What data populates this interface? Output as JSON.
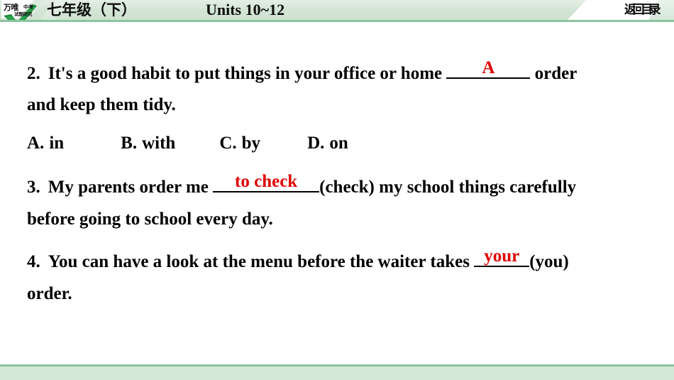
{
  "header": {
    "logo": {
      "brand_main": "万唯",
      "brand_sup": "中考",
      "brand_sub": "试题研究",
      "check_icon": "check-mark"
    },
    "title_cn": "七年级（下）",
    "title_en": "Units 10~12",
    "return_button": "返回目录"
  },
  "questions": [
    {
      "number": "2.",
      "line1_before": "It's a good habit to put things in your office or home",
      "answer": "A",
      "line1_after": "order",
      "line2": "and keep them tidy.",
      "options": [
        {
          "label": "A.",
          "text": "in"
        },
        {
          "label": "B.",
          "text": "with"
        },
        {
          "label": "C.",
          "text": "by"
        },
        {
          "label": "D.",
          "text": "on"
        }
      ]
    },
    {
      "number": "3.",
      "line1_before": "My parents order me",
      "answer": "to check",
      "line1_after": "(check) my school things carefully",
      "line2": "before going to school every day."
    },
    {
      "number": "4.",
      "line1_before": "You can have a look at the menu before the waiter takes",
      "answer": "your",
      "line1_after": "(you)",
      "line2": "order."
    }
  ],
  "colors": {
    "header_bg": "#d2e4d4",
    "header_border": "#8cc4a0",
    "answer_red": "#e00000",
    "logo_green": "#1c8a3c",
    "footer_bg": "#d5e7d7"
  }
}
